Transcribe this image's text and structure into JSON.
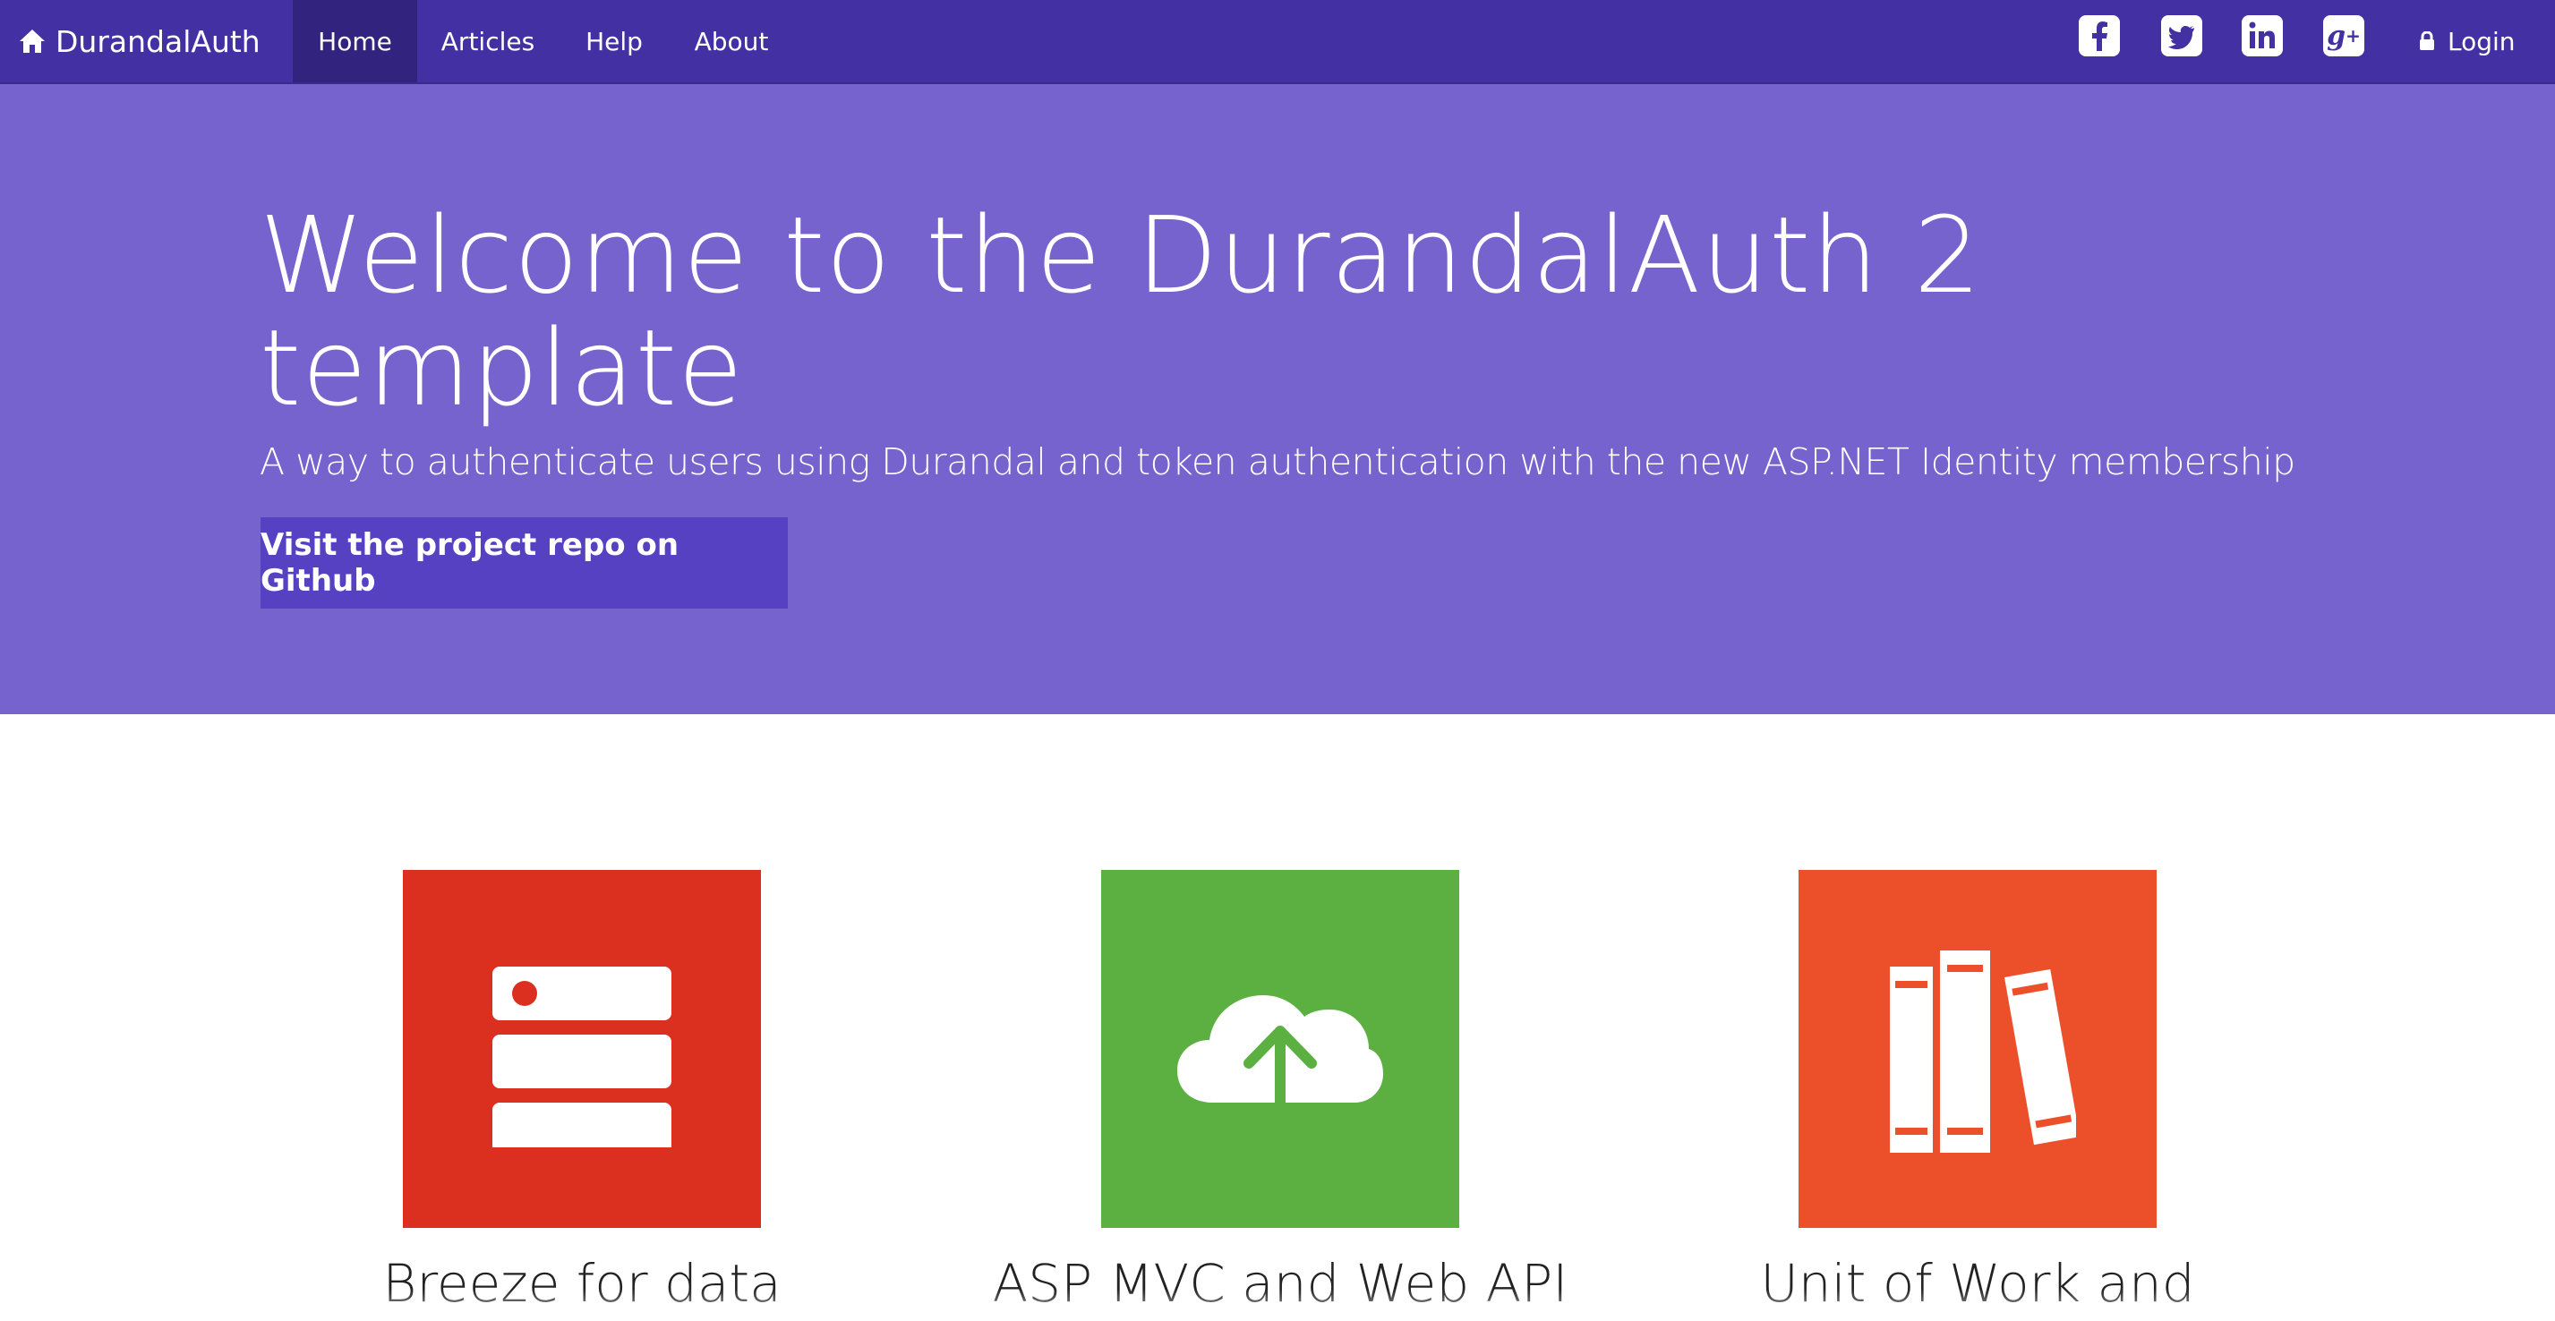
{
  "navbar": {
    "brand": "DurandalAuth",
    "items": [
      {
        "label": "Home",
        "active": true
      },
      {
        "label": "Articles",
        "active": false
      },
      {
        "label": "Help",
        "active": false
      },
      {
        "label": "About",
        "active": false
      }
    ],
    "social": [
      "facebook-icon",
      "twitter-icon",
      "linkedin-icon",
      "google-plus-icon"
    ],
    "login_label": "Login"
  },
  "hero": {
    "title": "Welcome to the DurandalAuth 2 template",
    "subtitle": "A way to authenticate users using Durandal and token authentication with the new ASP.NET Identity membership",
    "button_label": "Visit the project repo on Github",
    "background": "#7663cd",
    "button_color": "#5741c3"
  },
  "features": [
    {
      "title": "Breeze for data",
      "icon": "server-icon",
      "color": "#db2f20"
    },
    {
      "title": "ASP MVC and Web API",
      "icon": "cloud-upload-icon",
      "color": "#5cb042"
    },
    {
      "title": "Unit of Work and",
      "icon": "books-icon",
      "color": "#eb502b"
    }
  ],
  "colors": {
    "navbar": "#4331a3",
    "navbar_active": "#32247e"
  }
}
